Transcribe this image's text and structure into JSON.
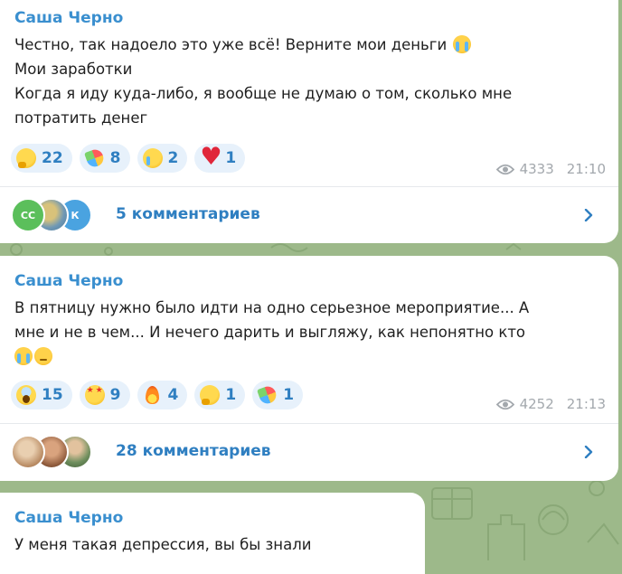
{
  "colors": {
    "chat_background": "#9db98a",
    "accent": "#2f7fc1",
    "author": "#3a8fcf",
    "meta": "#a3a8ad",
    "reaction_bg": "#e7f1fb"
  },
  "posts": [
    {
      "author": "Саша Черно",
      "lines": [
        "Честно, так надоело это уже всё! Верните мои деньги",
        "Мои заработки",
        "Когда я иду куда-либо, я вообще не думаю о том, сколько мне",
        "потратить денег"
      ],
      "line_emojis": [
        "loudly-crying-face"
      ],
      "reactions": [
        {
          "icon": "thinking-face-icon",
          "count": "22"
        },
        {
          "icon": "party-popper-icon",
          "count": "8"
        },
        {
          "icon": "crying-face-icon",
          "count": "2"
        },
        {
          "icon": "red-heart-icon",
          "count": "1"
        }
      ],
      "views": "4333",
      "time": "21:10",
      "comments": {
        "label": "5 комментариев",
        "avatars": [
          {
            "initials": "СС",
            "color": "#5bbf5b"
          },
          {
            "initials": "",
            "color": "#7ea8c9"
          },
          {
            "initials": "К",
            "color": "#4aa3e0"
          }
        ]
      }
    },
    {
      "author": "Саша Черно",
      "lines": [
        "В пятницу нужно было идти на одно серьезное мероприятие... А",
        "мне и не в чем... И нечего дарить и выгляжу, как непонятно кто"
      ],
      "line_emojis": [
        "loudly-crying-face",
        "pensive-face"
      ],
      "reactions": [
        {
          "icon": "screaming-face-icon",
          "count": "15"
        },
        {
          "icon": "star-struck-icon",
          "count": "9"
        },
        {
          "icon": "fire-icon",
          "count": "4"
        },
        {
          "icon": "thinking-face-icon",
          "count": "1"
        },
        {
          "icon": "party-popper-icon",
          "count": "1"
        }
      ],
      "views": "4252",
      "time": "21:13",
      "comments": {
        "label": "28 комментариев",
        "avatars": [
          {
            "initials": "",
            "color": "#c9a27e"
          },
          {
            "initials": "",
            "color": "#b07a5a"
          },
          {
            "initials": "",
            "color": "#7d9a6a"
          }
        ]
      }
    },
    {
      "author": "Саша Черно",
      "lines": [
        "У меня такая депрессия, вы бы знали"
      ]
    }
  ]
}
